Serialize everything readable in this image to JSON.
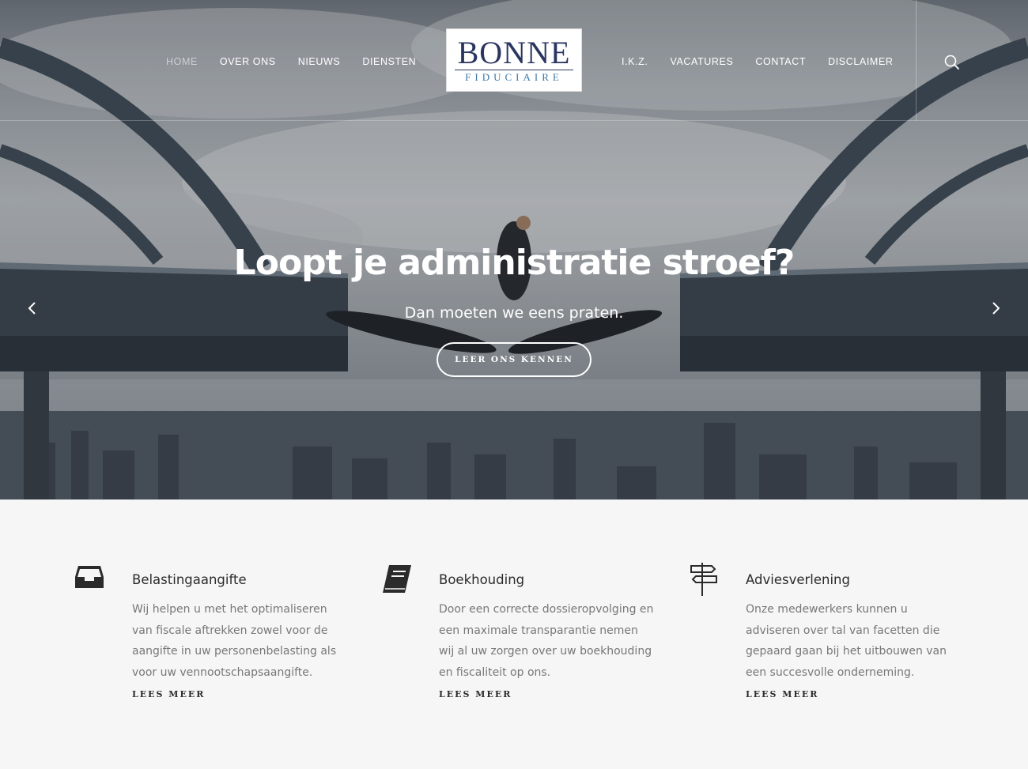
{
  "header": {
    "nav_left": [
      "HOME",
      "OVER ONS",
      "NIEUWS",
      "DIENSTEN"
    ],
    "nav_right": [
      "I.K.Z.",
      "VACATURES",
      "CONTACT",
      "DISCLAIMER"
    ],
    "logo": {
      "main": "BONNE",
      "sub": "FIDUCIAIRE"
    },
    "search_icon": "search-icon"
  },
  "hero": {
    "title": "Loopt je administratie stroef?",
    "subtitle": "Dan moeten we eens praten.",
    "button": "LEER ONS KENNEN",
    "prev_icon": "chevron-left-icon",
    "next_icon": "chevron-right-icon"
  },
  "services": [
    {
      "icon": "inbox-icon",
      "title": "Belastingaangifte",
      "text": "Wij helpen u met het optimaliseren van fiscale aftrekken zowel voor de aangifte in uw personenbelasting als voor uw vennootschapsaangifte.",
      "more": "LEES MEER"
    },
    {
      "icon": "book-icon",
      "title": "Boekhouding",
      "text": "Door een correcte dossieropvolging en een maximale transparantie nemen wij al uw zorgen over uw boekhouding en fiscaliteit op ons.",
      "more": "LEES MEER"
    },
    {
      "icon": "signpost-icon",
      "title": "Adviesverlening",
      "text": "Onze medewerkers kunnen u adviseren over tal van facetten die gepaard gaan bij het uitbouwen van een succesvolle onderneming.",
      "more": "LEES MEER"
    }
  ],
  "colors": {
    "logo_navy": "#2a3560",
    "logo_blue": "#3b78a8",
    "text_dark": "#2b2b2b",
    "text_muted": "#777777",
    "bg_light": "#f6f6f6"
  }
}
